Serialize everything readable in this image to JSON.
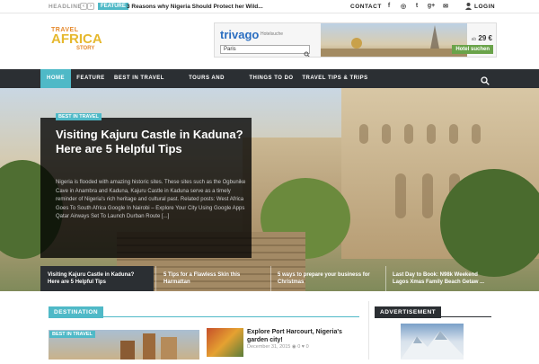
{
  "topbar": {
    "headline_label": "HEADLINE",
    "prev_arrow": "‹",
    "next_arrow": "›",
    "feature_tag": "FEATURE",
    "ticker_text": "3 Reasons why Nigeria Should Protect her Wild...",
    "contact": "CONTACT",
    "social": [
      {
        "icon": "facebook-icon",
        "glyph": "f"
      },
      {
        "icon": "instagram-icon",
        "glyph": "◎"
      },
      {
        "icon": "twitter-icon",
        "glyph": "t"
      },
      {
        "icon": "google-plus-icon",
        "glyph": "g+"
      },
      {
        "icon": "email-icon",
        "glyph": "✉"
      }
    ],
    "login": "LOGIN"
  },
  "logo": {
    "line1": "TRAVEL",
    "line2": "AFRICA",
    "line3": "STORY"
  },
  "ad": {
    "brand": "trivago",
    "sub": "Hotelsuche",
    "search_value": "Paris",
    "price_prefix": "ab",
    "price": "29 €",
    "button": "Hotel suchen"
  },
  "nav": {
    "items": [
      "HOME",
      "FEATURE",
      "BEST IN TRAVEL",
      "TOURS AND PACKAGES",
      "THINGS TO DO",
      "TRAVEL TIPS & TRIPS"
    ],
    "active_index": 0
  },
  "hero": {
    "category": "BEST IN TRAVEL",
    "title": "Visiting Kajuru Castle in Kaduna? Here are 5 Helpful Tips",
    "excerpt": "Nigeria is flooded with amazing historic sites. These sites such as the Ogbunike Cave in Anambra and Kaduna, Kajuru Castle in Kaduna serve as a timely reminder of Nigeria's rich heritage and cultural past. Related posts: West Africa Goes To South Africa Google In Nairobi – Explore Your City Using Google Apps Qatar Airways Set To Launch Durban Route [...]"
  },
  "slides": [
    "Visiting Kajuru Castle in Kaduna? Here are 5 Helpful Tips",
    "5 Tips for a Flawless Skin this Harmattan",
    "5 ways to prepare your business for Christmas",
    "Last Day to Book: N98k Weekend Lagos Xmas Family Beach Getaw ..."
  ],
  "destination": {
    "section_label": "DESTINATION",
    "card_category": "BEST IN TRAVEL",
    "post_title": "Explore Port Harcourt, Nigeria's garden city!",
    "post_date": "December 31, 2015",
    "views": "0",
    "likes": "0"
  },
  "advertisement": {
    "label": "ADVERTISEMENT"
  },
  "colors": {
    "accent": "#4fb9c7",
    "nav": "#2b2f33"
  }
}
